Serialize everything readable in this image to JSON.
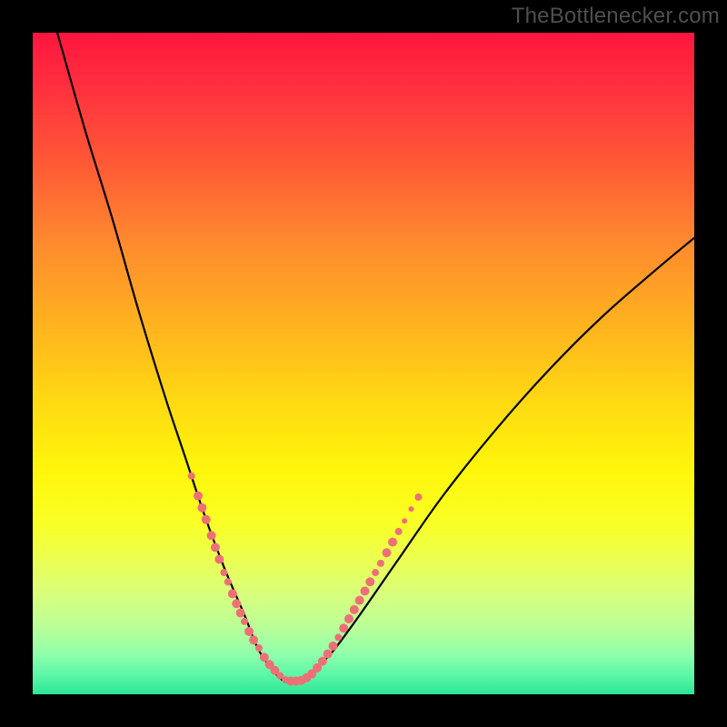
{
  "watermark": "TheBottlenecker.com",
  "colors": {
    "frame": "#000000",
    "curve": "#000000",
    "dot_fill": "#ee7077",
    "dot_stroke": "#ee7077",
    "gradient_top": "#ff153e",
    "gradient_bottom": "#2ce696"
  },
  "chart_data": {
    "type": "line",
    "title": "",
    "xlabel": "",
    "ylabel": "",
    "xlim": [
      0,
      100
    ],
    "ylim": [
      0,
      100
    ],
    "grid": false,
    "legend": false,
    "series": [
      {
        "name": "bottleneck-curve",
        "x": [
          0,
          4,
          8,
          12,
          16,
          20,
          23,
          26,
          29,
          32,
          34,
          36,
          38,
          40,
          44,
          48,
          55,
          62,
          70,
          78,
          86,
          94,
          100
        ],
        "y": [
          113,
          99,
          85,
          72,
          58,
          45,
          36,
          27,
          19,
          12,
          7,
          4,
          2,
          2,
          5,
          10,
          20,
          30,
          40,
          49,
          57,
          64,
          69
        ]
      }
    ],
    "markers": {
      "name": "highlight-dots",
      "points": [
        {
          "x": 24.0,
          "y": 33.0,
          "r": 4
        },
        {
          "x": 25.0,
          "y": 30.0,
          "r": 5
        },
        {
          "x": 25.6,
          "y": 28.2,
          "r": 5
        },
        {
          "x": 26.2,
          "y": 26.4,
          "r": 5
        },
        {
          "x": 27.0,
          "y": 24.0,
          "r": 5
        },
        {
          "x": 27.6,
          "y": 22.2,
          "r": 5
        },
        {
          "x": 28.2,
          "y": 20.4,
          "r": 5
        },
        {
          "x": 28.9,
          "y": 18.4,
          "r": 4
        },
        {
          "x": 29.5,
          "y": 17.0,
          "r": 4
        },
        {
          "x": 30.2,
          "y": 15.2,
          "r": 5
        },
        {
          "x": 30.8,
          "y": 13.7,
          "r": 5
        },
        {
          "x": 31.4,
          "y": 12.3,
          "r": 5
        },
        {
          "x": 32.0,
          "y": 11.0,
          "r": 4
        },
        {
          "x": 32.7,
          "y": 9.5,
          "r": 5
        },
        {
          "x": 33.4,
          "y": 8.2,
          "r": 5
        },
        {
          "x": 34.2,
          "y": 7.0,
          "r": 4
        },
        {
          "x": 35.0,
          "y": 5.6,
          "r": 5
        },
        {
          "x": 35.8,
          "y": 4.5,
          "r": 5
        },
        {
          "x": 36.6,
          "y": 3.6,
          "r": 5
        },
        {
          "x": 37.4,
          "y": 2.8,
          "r": 4
        },
        {
          "x": 38.2,
          "y": 2.2,
          "r": 4
        },
        {
          "x": 39.0,
          "y": 2.0,
          "r": 5
        },
        {
          "x": 39.8,
          "y": 2.0,
          "r": 5
        },
        {
          "x": 40.6,
          "y": 2.1,
          "r": 5
        },
        {
          "x": 41.4,
          "y": 2.5,
          "r": 5
        },
        {
          "x": 42.2,
          "y": 3.1,
          "r": 5
        },
        {
          "x": 43.0,
          "y": 4.0,
          "r": 5
        },
        {
          "x": 43.8,
          "y": 5.0,
          "r": 5
        },
        {
          "x": 44.6,
          "y": 6.1,
          "r": 5
        },
        {
          "x": 45.4,
          "y": 7.3,
          "r": 5
        },
        {
          "x": 46.2,
          "y": 8.6,
          "r": 4
        },
        {
          "x": 47.0,
          "y": 10.0,
          "r": 5
        },
        {
          "x": 47.8,
          "y": 11.4,
          "r": 5
        },
        {
          "x": 48.6,
          "y": 12.8,
          "r": 5
        },
        {
          "x": 49.4,
          "y": 14.2,
          "r": 5
        },
        {
          "x": 50.2,
          "y": 15.6,
          "r": 5
        },
        {
          "x": 51.0,
          "y": 17.0,
          "r": 5
        },
        {
          "x": 51.8,
          "y": 18.4,
          "r": 4
        },
        {
          "x": 52.6,
          "y": 19.8,
          "r": 4
        },
        {
          "x": 53.5,
          "y": 21.4,
          "r": 5
        },
        {
          "x": 54.4,
          "y": 23.0,
          "r": 5
        },
        {
          "x": 55.3,
          "y": 24.6,
          "r": 4
        },
        {
          "x": 56.2,
          "y": 26.2,
          "r": 3
        },
        {
          "x": 57.2,
          "y": 28.0,
          "r": 3
        },
        {
          "x": 58.3,
          "y": 29.8,
          "r": 4
        }
      ]
    }
  }
}
